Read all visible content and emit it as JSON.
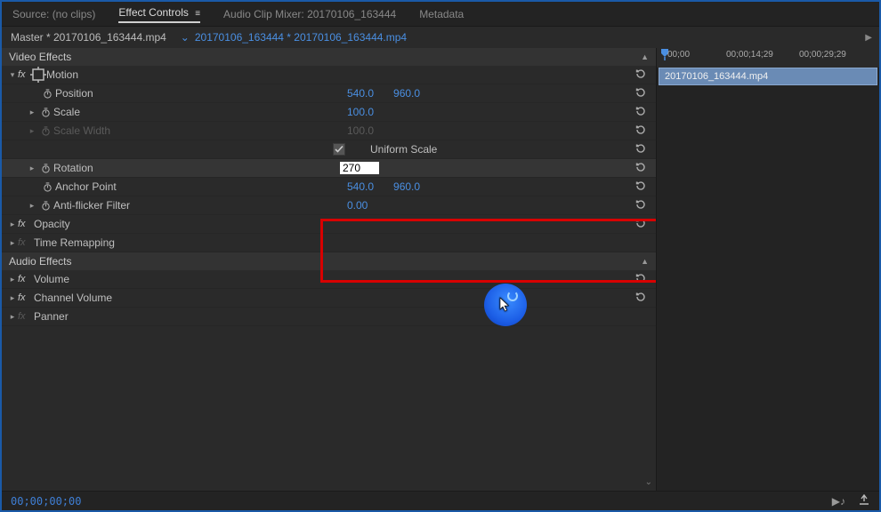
{
  "tabs": {
    "source": "Source: (no clips)",
    "effect_controls": "Effect Controls",
    "audio_mixer": "Audio Clip Mixer: 20170106_163444",
    "metadata": "Metadata"
  },
  "crumb": {
    "master": "Master * 20170106_163444.mp4",
    "clip": "20170106_163444 * 20170106_163444.mp4"
  },
  "sections": {
    "video": "Video Effects",
    "audio": "Audio Effects"
  },
  "motion": {
    "label": "Motion",
    "position_label": "Position",
    "position_x": "540.0",
    "position_y": "960.0",
    "scale_label": "Scale",
    "scale_value": "100.0",
    "scale_width_label": "Scale Width",
    "scale_width_value": "100.0",
    "uniform_label": "Uniform Scale",
    "rotation_label": "Rotation",
    "rotation_value": "270",
    "anchor_label": "Anchor Point",
    "anchor_x": "540.0",
    "anchor_y": "960.0",
    "antiflicker_label": "Anti-flicker Filter",
    "antiflicker_value": "0.00"
  },
  "opacity": {
    "label": "Opacity"
  },
  "remap": {
    "label": "Time Remapping"
  },
  "volume": {
    "label": "Volume"
  },
  "channel_volume": {
    "label": "Channel Volume"
  },
  "panner": {
    "label": "Panner"
  },
  "timeline": {
    "t0": "00;00",
    "t1": "00;00;14;29",
    "t2": "00;00;29;29",
    "clip_name": "20170106_163444.mp4"
  },
  "footer": {
    "timecode": "00;00;00;00"
  }
}
